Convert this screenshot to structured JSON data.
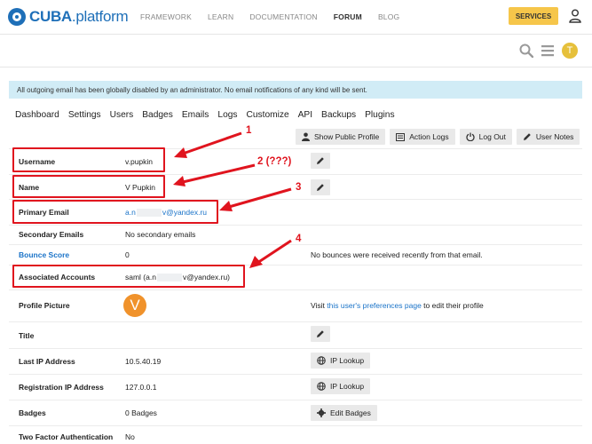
{
  "site": {
    "logo_bold": "CUBA",
    "logo_rest": ".platform",
    "nav": [
      "FRAMEWORK",
      "LEARN",
      "DOCUMENTATION",
      "FORUM",
      "BLOG"
    ],
    "services_label": "SERVICES",
    "avatar_letter": "T"
  },
  "alert": "All outgoing email has been globally disabled by an administrator. No email notifications of any kind will be sent.",
  "admin_tabs": [
    "Dashboard",
    "Settings",
    "Users",
    "Badges",
    "Emails",
    "Logs",
    "Customize",
    "API",
    "Backups",
    "Plugins"
  ],
  "actions": {
    "show_public_profile": "Show Public Profile",
    "action_logs": "Action Logs",
    "log_out": "Log Out",
    "user_notes": "User Notes"
  },
  "fields": {
    "username": {
      "label": "Username",
      "value": "v.pupkin"
    },
    "name": {
      "label": "Name",
      "value": "V Pupkin"
    },
    "primary_email": {
      "label": "Primary Email",
      "value_start": "a.n",
      "value_end": "v@yandex.ru"
    },
    "secondary_emails": {
      "label": "Secondary Emails",
      "value": "No secondary emails"
    },
    "bounce_score": {
      "label": "Bounce Score",
      "value": "0",
      "note": "No bounces were received recently from that email."
    },
    "associated_accounts": {
      "label": "Associated Accounts",
      "value_start": "saml (a.n",
      "value_end": "v@yandex.ru)"
    },
    "profile_picture": {
      "label": "Profile Picture",
      "avatar_letter": "V",
      "note_before": "Visit ",
      "note_link": "this user's preferences page",
      "note_after": " to edit their profile"
    },
    "title": {
      "label": "Title"
    },
    "last_ip": {
      "label": "Last IP Address",
      "value": "10.5.40.19",
      "button": "IP Lookup"
    },
    "registration_ip": {
      "label": "Registration IP Address",
      "value": "127.0.0.1",
      "button": "IP Lookup"
    },
    "badges": {
      "label": "Badges",
      "value": "0 Badges",
      "button": "Edit Badges"
    },
    "two_factor": {
      "label": "Two Factor Authentication",
      "value": "No"
    }
  },
  "annotations": [
    "1",
    "2 (???)",
    "3",
    "4"
  ],
  "colors": {
    "accent": "#1e6fb8",
    "services": "#f6c64a",
    "alert_bg": "#d1ecf6",
    "annotation": "#e0141e",
    "link": "#1a73c8"
  }
}
